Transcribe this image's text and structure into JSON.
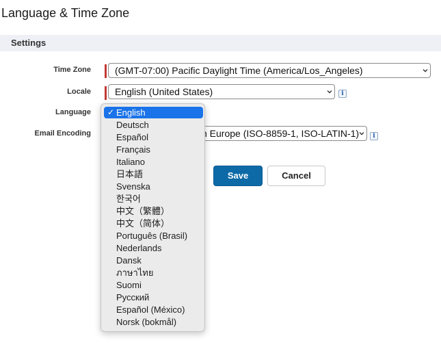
{
  "page": {
    "title": "Language & Time Zone"
  },
  "section": {
    "title": "Settings"
  },
  "fields": {
    "timezone": {
      "label": "Time Zone",
      "value": "(GMT-07:00) Pacific Daylight Time (America/Los_Angeles)"
    },
    "locale": {
      "label": "Locale",
      "value": "English (United States)"
    },
    "language": {
      "label": "Language",
      "value": "English"
    },
    "encoding": {
      "label": "Email Encoding",
      "value": "General US & Western Europe (ISO-8859-1, ISO-LATIN-1)",
      "visible_text": "n Europe (ISO-8859-1, ISO-LATIN-1)"
    }
  },
  "buttons": {
    "save": "Save",
    "cancel": "Cancel"
  },
  "language_dropdown": {
    "selected_index": 0,
    "checkmark": "✓",
    "options": [
      "English",
      "Deutsch",
      "Español",
      "Français",
      "Italiano",
      "日本語",
      "Svenska",
      "한국어",
      "中文（繁體）",
      "中文（简体）",
      "Português (Brasil)",
      "Nederlands",
      "Dansk",
      "ภาษาไทย",
      "Suomi",
      "Русский",
      "Español (México)",
      "Norsk (bokmål)"
    ]
  },
  "icons": {
    "info": "info-icon",
    "chevron": "chevron-down-icon"
  },
  "colors": {
    "accent": "#1a73e8",
    "save_button": "#0d6aa7",
    "required": "#c23934",
    "section_bg": "#eef0f5"
  }
}
